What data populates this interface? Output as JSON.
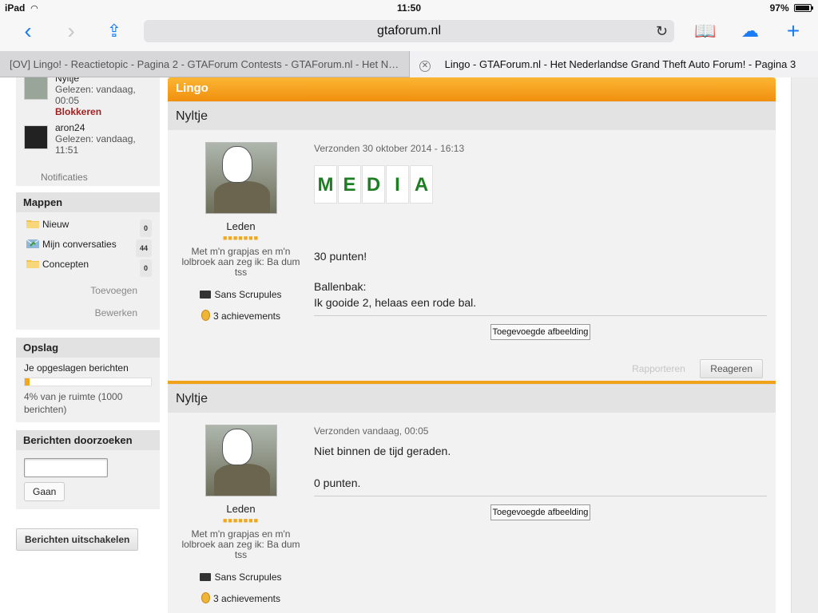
{
  "statusbar": {
    "device": "iPad",
    "time": "11:50",
    "battery": "97%"
  },
  "browser": {
    "url": "gtaforum.nl",
    "tabs": [
      {
        "title": "[OV] Lingo! - Reactietopic - Pagina 2 - GTAForum Contests - GTAForum.nl - Het Ned..."
      },
      {
        "title": "Lingo - GTAForum.nl - Het Nederlandse Grand Theft Auto Forum! - Pagina 3"
      }
    ]
  },
  "sidebar": {
    "viewers": [
      {
        "name": "Nyltje",
        "seen": "Gelezen: vandaag, 00:05",
        "action": "Blokkeren"
      },
      {
        "name": "aron24",
        "seen": "Gelezen: vandaag, 11:51"
      }
    ],
    "notifications": "Notificaties",
    "folders": {
      "title": "Mappen",
      "items": [
        {
          "label": "Nieuw",
          "count": "0"
        },
        {
          "label": "Mijn conversaties",
          "count": "44"
        },
        {
          "label": "Concepten",
          "count": "0"
        }
      ],
      "add": "Toevoegen",
      "edit": "Bewerken"
    },
    "storage": {
      "title": "Opslag",
      "label": "Je opgeslagen berichten",
      "usage_percent": 4,
      "sub": "4% van je ruimte (1000 berichten)"
    },
    "search": {
      "title": "Berichten doorzoeken",
      "button": "Gaan"
    },
    "disable_button": "Berichten uitschakelen"
  },
  "topic": {
    "title": "Lingo",
    "posts": [
      {
        "author": "Nyltje",
        "rank": "Leden",
        "quote": "Met m'n grapjas en m'n lolbroek aan zeg ik: Ba dum tss",
        "award": "Sans Scrupules",
        "achievements": "3 achievements",
        "sent": "Verzonden 30 oktober 2014 - 16:13",
        "letters": [
          "M",
          "E",
          "D",
          "I",
          "A"
        ],
        "lines": [
          "30 punten!",
          "Ballenbak:",
          "Ik gooide 2, helaas een rode bal."
        ],
        "attachment": "Toegevoegde afbeelding",
        "report": "Rapporteren",
        "reply": "Reageren"
      },
      {
        "author": "Nyltje",
        "rank": "Leden",
        "quote": "Met m'n grapjas en m'n lolbroek aan zeg ik: Ba dum tss",
        "award": "Sans Scrupules",
        "achievements": "3 achievements",
        "sent": "Verzonden vandaag, 00:05",
        "lines": [
          "Niet binnen de tijd geraden.",
          "0 punten."
        ],
        "attachment": "Toegevoegde afbeelding"
      }
    ]
  }
}
